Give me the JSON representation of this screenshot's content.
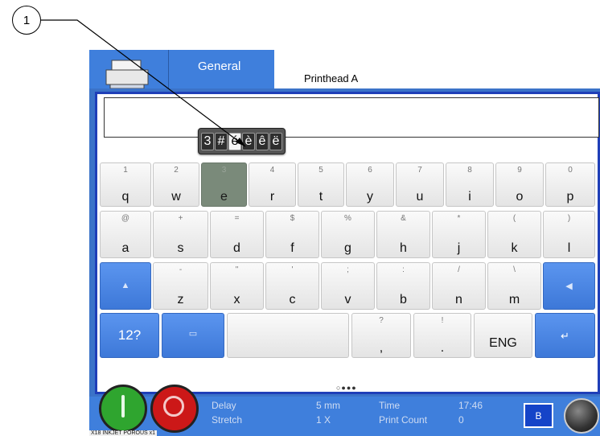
{
  "callout": {
    "number": "1"
  },
  "tabs": {
    "general": "General",
    "printhead": "Printhead A"
  },
  "text_field": {
    "value": ""
  },
  "accent_popup": [
    "3",
    "#",
    "é",
    "è",
    "ê",
    "ë"
  ],
  "accent_selected_index": 2,
  "rows": [
    [
      {
        "sec": "1",
        "pri": "q"
      },
      {
        "sec": "2",
        "pri": "w"
      },
      {
        "sec": "3",
        "pri": "e"
      },
      {
        "sec": "4",
        "pri": "r"
      },
      {
        "sec": "5",
        "pri": "t"
      },
      {
        "sec": "6",
        "pri": "y"
      },
      {
        "sec": "7",
        "pri": "u"
      },
      {
        "sec": "8",
        "pri": "i"
      },
      {
        "sec": "9",
        "pri": "o"
      },
      {
        "sec": "0",
        "pri": "p"
      }
    ],
    [
      {
        "sec": "@",
        "pri": "a"
      },
      {
        "sec": "+",
        "pri": "s"
      },
      {
        "sec": "=",
        "pri": "d"
      },
      {
        "sec": "$",
        "pri": "f"
      },
      {
        "sec": "%",
        "pri": "g"
      },
      {
        "sec": "&",
        "pri": "h"
      },
      {
        "sec": "*",
        "pri": "j"
      },
      {
        "sec": "(",
        "pri": "k"
      },
      {
        "sec": ")",
        "pri": "l"
      }
    ],
    [
      {
        "sec": "-",
        "pri": "z"
      },
      {
        "sec": "\"",
        "pri": "x"
      },
      {
        "sec": "'",
        "pri": "c"
      },
      {
        "sec": ";",
        "pri": "v"
      },
      {
        "sec": ":",
        "pri": "b"
      },
      {
        "sec": "/",
        "pri": "n"
      },
      {
        "sec": "\\",
        "pri": "m"
      }
    ],
    [
      {
        "sec": "?",
        "pri": ","
      },
      {
        "sec": "!",
        "pri": "."
      }
    ]
  ],
  "special_keys": {
    "numeric": "12?",
    "language": "ENG"
  },
  "icons": {
    "shift": "shift-arrow-icon",
    "backspace": "backspace-arrow-icon",
    "enter": "enter-arrow-icon",
    "keyboard": "keyboard-hide-icon",
    "printer": "printer-icon"
  },
  "page_indicator": "○●●●",
  "status": {
    "delay_label": "Delay",
    "delay_value": "5 mm",
    "stretch_label": "Stretch",
    "stretch_value": "1 X",
    "time_label": "Time",
    "time_value": "17:46",
    "print_count_label": "Print Count",
    "print_count_value": "0",
    "b_button": "B",
    "footer": "X18 INKJET POROUS x1"
  },
  "colors": {
    "accent_blue": "#3f7fdc",
    "frame_blue": "#1f3fb8",
    "start_green": "#2fa52f",
    "stop_red": "#cc1818"
  }
}
